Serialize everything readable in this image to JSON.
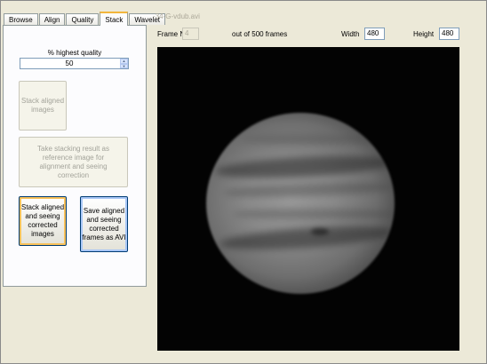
{
  "tabs": [
    {
      "label": "Browse",
      "active": false
    },
    {
      "label": "Align",
      "active": false
    },
    {
      "label": "Quality",
      "active": false
    },
    {
      "label": "Stack",
      "active": true
    },
    {
      "label": "Wavelet",
      "active": false
    }
  ],
  "stack_panel": {
    "quality_label": "% highest quality",
    "quality_value": "50",
    "stack_aligned_label": "Stack aligned images",
    "take_result_label": "Take stacking result as reference image for alignment and seeing correction",
    "stack_corrected_label": "Stack aligned and seeing corrected images",
    "save_frames_label": "Save aligned and seeing corrected frames as AVI"
  },
  "viewer": {
    "file_title": "-34-G-vdub.avi",
    "frame_label": "Frame Nr",
    "frame_value": "4",
    "frame_total_text": "out of 500 frames",
    "width_label": "Width",
    "width_value": "480",
    "height_label": "Height",
    "height_value": "480"
  }
}
